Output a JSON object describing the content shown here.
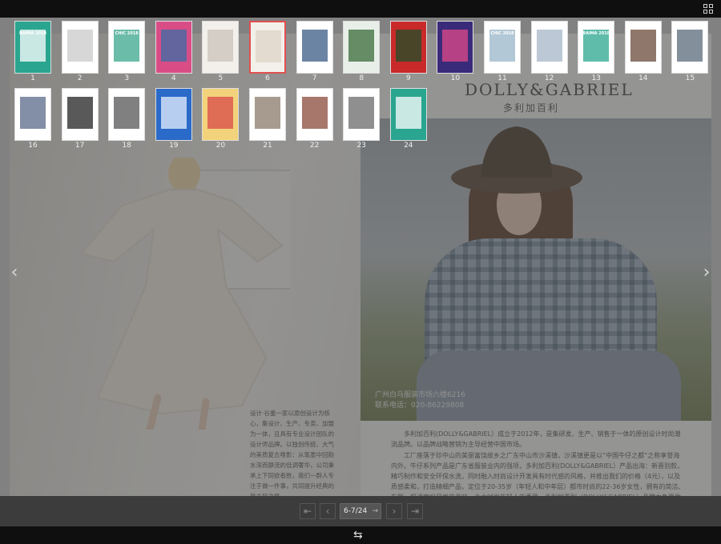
{
  "viewer": {
    "grid_icon": "grid-icon",
    "prev_icon": "chevron-left-icon",
    "next_icon": "chevron-right-icon",
    "swap_icon": "swap-icon"
  },
  "thumbnails": [
    {
      "num": "1",
      "label": "BAIMA 2018"
    },
    {
      "num": "2"
    },
    {
      "num": "3",
      "label": "CHIC 2018"
    },
    {
      "num": "4"
    },
    {
      "num": "5"
    },
    {
      "num": "6",
      "active": true
    },
    {
      "num": "7"
    },
    {
      "num": "8"
    },
    {
      "num": "9"
    },
    {
      "num": "10"
    },
    {
      "num": "11",
      "label": "CHIC 2018"
    },
    {
      "num": "12"
    },
    {
      "num": "13",
      "label": "BAIMA 2018"
    },
    {
      "num": "14"
    },
    {
      "num": "15"
    },
    {
      "num": "16"
    },
    {
      "num": "17"
    },
    {
      "num": "18"
    },
    {
      "num": "19"
    },
    {
      "num": "20"
    },
    {
      "num": "21"
    },
    {
      "num": "22"
    },
    {
      "num": "23"
    },
    {
      "num": "24"
    }
  ],
  "left_page": {
    "text": "设计·谷重一家以原创设计为核心，集设计、生产、专卖、加盟为一体，且具有专业设计团队的设计师品牌。以独创传统、大气的美质复古唯影：从笔墨中回韵水深而静流的低调奢华，公司秉承上下同欲者胜，我们一群人专注于做一件事，共同提升经典的复古风之路。"
  },
  "right_page": {
    "brand": "DOLLY&GABRIEL",
    "brand_cn": "多利加百利",
    "photo_address": "广州白马服装市场六楼6216",
    "photo_phone": "联系电话：020-86229808",
    "paragraph_1": "多利加百利(DOLLY&GABRIEL）成立于2012年，是集研发、生产、销售于一体的原创设计时尚潮流品牌。以品牌战略营销为主导经营中国市场。",
    "paragraph_2": "工厂座落于珍中山的美丽富饶故乡之广东中山市沙溪镇，沙溪镇更是以“中国牛仔之都”之称享誉海内外。牛仔系列产品是广东省服装业内的强项，多利加百利(DOLLY&GABRIEL）产品出海：新晋别款，精巧制作和安全环保水洗，同时融入时尚设计开发具有时代感的风格，并推出我们的价格（4元），以及质感柔和，打造精细产品，定位于20-35岁（年轻人和中年层）都市时尚的22-36岁女性，拥有的简洁、有型、舒适宽松风格的品味一个大时尚年轻人的喜爱。多利加百利（DOLLY&GABRIEL）品牌力争要做第一牛仔品牌，推向全国，走向世界。"
  },
  "pagination": {
    "first_icon": "first-page-icon",
    "prev_icon": "prev-page-icon",
    "page_value": "6-7/24",
    "go_icon": "go-arrow-icon",
    "next_icon": "next-page-icon",
    "last_icon": "last-page-icon"
  },
  "colors": {
    "active_thumb": "#e05050",
    "teal": "#2aa58f",
    "bar": "#3c3c3c"
  }
}
